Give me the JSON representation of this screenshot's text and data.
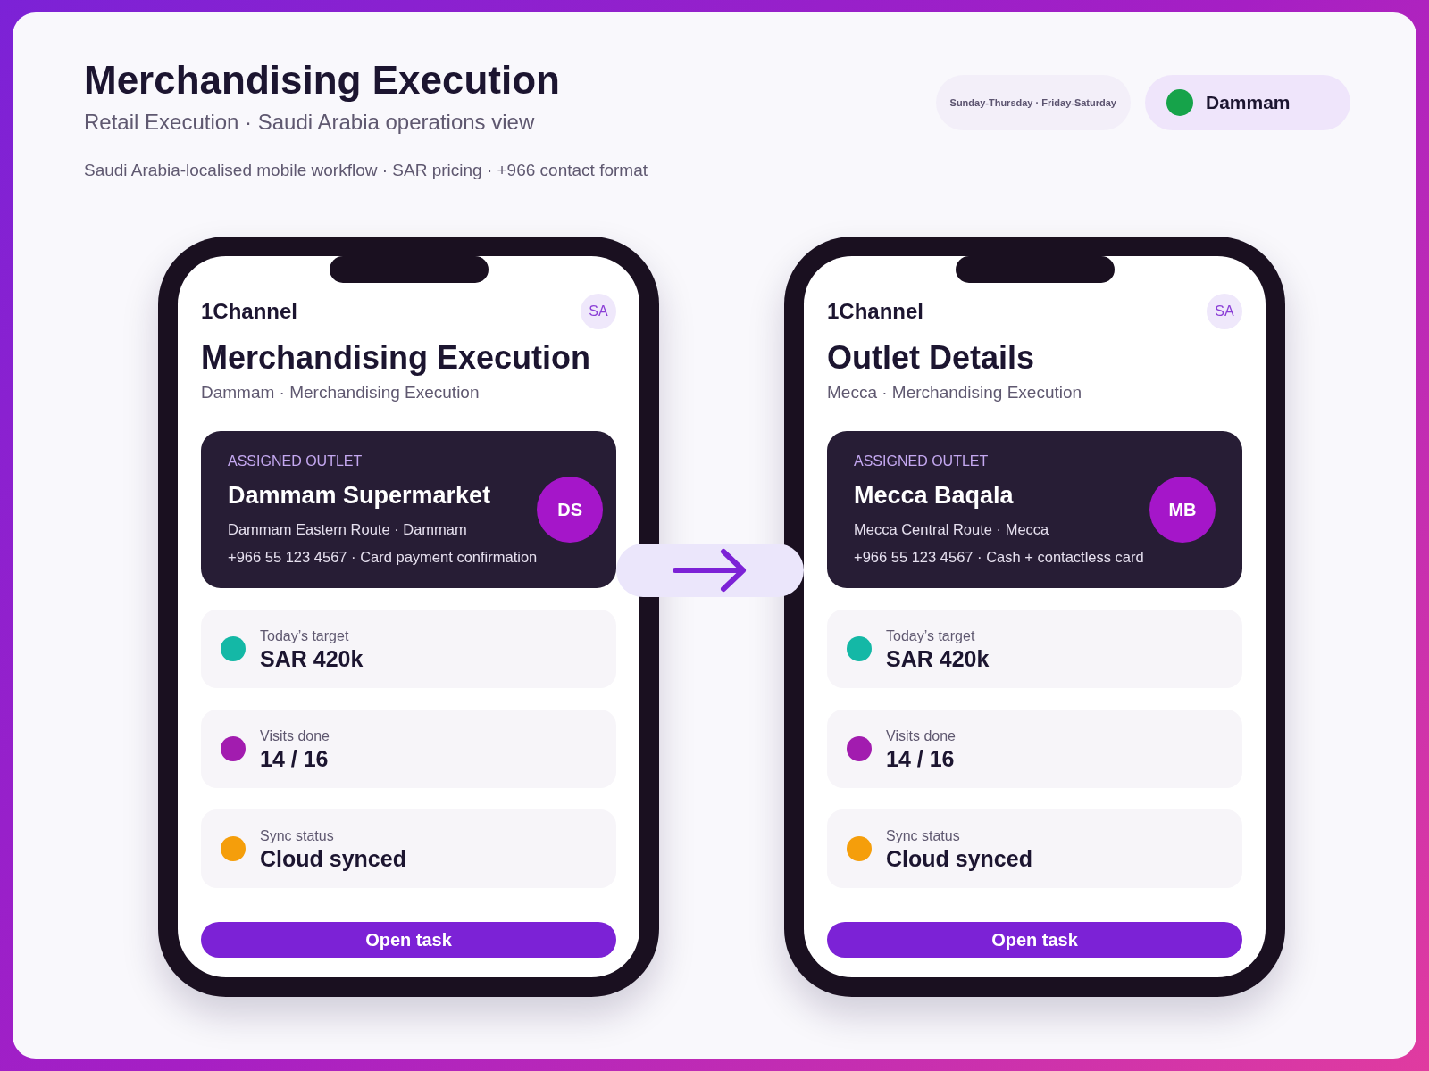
{
  "header": {
    "title": "Merchandising Execution",
    "subtitle": "Retail Execution · Saudi Arabia operations view",
    "note": "Saudi Arabia-localised mobile workflow · SAR pricing · +966 contact format"
  },
  "chips": [
    {
      "kind": "text",
      "label": "Sunday-Thursday · Friday-Saturday"
    },
    {
      "kind": "location",
      "label": "Dammam",
      "color": "#16a34a"
    }
  ],
  "phones": [
    {
      "brand": "1Channel",
      "avatar": "SA",
      "title": "Merchandising Execution",
      "subtitle": "Dammam · Merchandising Execution",
      "outlet": {
        "eyebrow": "ASSIGNED OUTLET",
        "name": "Dammam Supermarket",
        "route": "Dammam Eastern Route · Dammam",
        "contact": "+966 55 123 4567 · Card payment confirmation",
        "initials": "DS"
      },
      "stats": [
        {
          "label": "Today’s target",
          "value": "SAR 420k",
          "color": "#14b8a6"
        },
        {
          "label": "Visits done",
          "value": "14 / 16",
          "color": "#a21caf"
        },
        {
          "label": "Sync status",
          "value": "Cloud synced",
          "color": "#f59e0b"
        }
      ],
      "button": "Open task"
    },
    {
      "brand": "1Channel",
      "avatar": "SA",
      "title": "Outlet Details",
      "subtitle": "Mecca · Merchandising Execution",
      "outlet": {
        "eyebrow": "ASSIGNED OUTLET",
        "name": "Mecca Baqala",
        "route": "Mecca Central Route · Mecca",
        "contact": "+966 55 123 4567 · Cash + contactless card",
        "initials": "MB"
      },
      "stats": [
        {
          "label": "Today’s target",
          "value": "SAR 420k",
          "color": "#14b8a6"
        },
        {
          "label": "Visits done",
          "value": "14 / 16",
          "color": "#a21caf"
        },
        {
          "label": "Sync status",
          "value": "Cloud synced",
          "color": "#f59e0b"
        }
      ],
      "button": "Open task"
    }
  ]
}
